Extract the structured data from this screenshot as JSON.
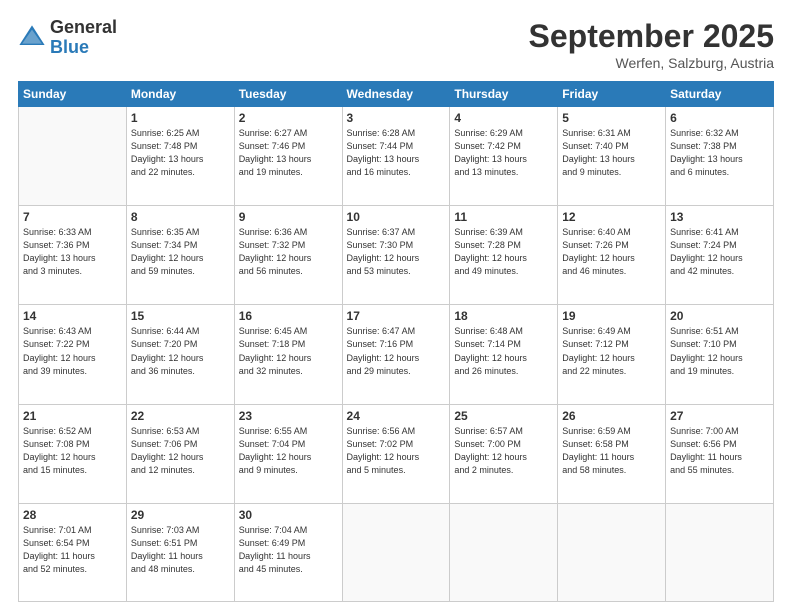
{
  "logo": {
    "general": "General",
    "blue": "Blue"
  },
  "header": {
    "month": "September 2025",
    "location": "Werfen, Salzburg, Austria"
  },
  "weekdays": [
    "Sunday",
    "Monday",
    "Tuesday",
    "Wednesday",
    "Thursday",
    "Friday",
    "Saturday"
  ],
  "weeks": [
    [
      {
        "day": "",
        "info": ""
      },
      {
        "day": "1",
        "info": "Sunrise: 6:25 AM\nSunset: 7:48 PM\nDaylight: 13 hours\nand 22 minutes."
      },
      {
        "day": "2",
        "info": "Sunrise: 6:27 AM\nSunset: 7:46 PM\nDaylight: 13 hours\nand 19 minutes."
      },
      {
        "day": "3",
        "info": "Sunrise: 6:28 AM\nSunset: 7:44 PM\nDaylight: 13 hours\nand 16 minutes."
      },
      {
        "day": "4",
        "info": "Sunrise: 6:29 AM\nSunset: 7:42 PM\nDaylight: 13 hours\nand 13 minutes."
      },
      {
        "day": "5",
        "info": "Sunrise: 6:31 AM\nSunset: 7:40 PM\nDaylight: 13 hours\nand 9 minutes."
      },
      {
        "day": "6",
        "info": "Sunrise: 6:32 AM\nSunset: 7:38 PM\nDaylight: 13 hours\nand 6 minutes."
      }
    ],
    [
      {
        "day": "7",
        "info": "Sunrise: 6:33 AM\nSunset: 7:36 PM\nDaylight: 13 hours\nand 3 minutes."
      },
      {
        "day": "8",
        "info": "Sunrise: 6:35 AM\nSunset: 7:34 PM\nDaylight: 12 hours\nand 59 minutes."
      },
      {
        "day": "9",
        "info": "Sunrise: 6:36 AM\nSunset: 7:32 PM\nDaylight: 12 hours\nand 56 minutes."
      },
      {
        "day": "10",
        "info": "Sunrise: 6:37 AM\nSunset: 7:30 PM\nDaylight: 12 hours\nand 53 minutes."
      },
      {
        "day": "11",
        "info": "Sunrise: 6:39 AM\nSunset: 7:28 PM\nDaylight: 12 hours\nand 49 minutes."
      },
      {
        "day": "12",
        "info": "Sunrise: 6:40 AM\nSunset: 7:26 PM\nDaylight: 12 hours\nand 46 minutes."
      },
      {
        "day": "13",
        "info": "Sunrise: 6:41 AM\nSunset: 7:24 PM\nDaylight: 12 hours\nand 42 minutes."
      }
    ],
    [
      {
        "day": "14",
        "info": "Sunrise: 6:43 AM\nSunset: 7:22 PM\nDaylight: 12 hours\nand 39 minutes."
      },
      {
        "day": "15",
        "info": "Sunrise: 6:44 AM\nSunset: 7:20 PM\nDaylight: 12 hours\nand 36 minutes."
      },
      {
        "day": "16",
        "info": "Sunrise: 6:45 AM\nSunset: 7:18 PM\nDaylight: 12 hours\nand 32 minutes."
      },
      {
        "day": "17",
        "info": "Sunrise: 6:47 AM\nSunset: 7:16 PM\nDaylight: 12 hours\nand 29 minutes."
      },
      {
        "day": "18",
        "info": "Sunrise: 6:48 AM\nSunset: 7:14 PM\nDaylight: 12 hours\nand 26 minutes."
      },
      {
        "day": "19",
        "info": "Sunrise: 6:49 AM\nSunset: 7:12 PM\nDaylight: 12 hours\nand 22 minutes."
      },
      {
        "day": "20",
        "info": "Sunrise: 6:51 AM\nSunset: 7:10 PM\nDaylight: 12 hours\nand 19 minutes."
      }
    ],
    [
      {
        "day": "21",
        "info": "Sunrise: 6:52 AM\nSunset: 7:08 PM\nDaylight: 12 hours\nand 15 minutes."
      },
      {
        "day": "22",
        "info": "Sunrise: 6:53 AM\nSunset: 7:06 PM\nDaylight: 12 hours\nand 12 minutes."
      },
      {
        "day": "23",
        "info": "Sunrise: 6:55 AM\nSunset: 7:04 PM\nDaylight: 12 hours\nand 9 minutes."
      },
      {
        "day": "24",
        "info": "Sunrise: 6:56 AM\nSunset: 7:02 PM\nDaylight: 12 hours\nand 5 minutes."
      },
      {
        "day": "25",
        "info": "Sunrise: 6:57 AM\nSunset: 7:00 PM\nDaylight: 12 hours\nand 2 minutes."
      },
      {
        "day": "26",
        "info": "Sunrise: 6:59 AM\nSunset: 6:58 PM\nDaylight: 11 hours\nand 58 minutes."
      },
      {
        "day": "27",
        "info": "Sunrise: 7:00 AM\nSunset: 6:56 PM\nDaylight: 11 hours\nand 55 minutes."
      }
    ],
    [
      {
        "day": "28",
        "info": "Sunrise: 7:01 AM\nSunset: 6:54 PM\nDaylight: 11 hours\nand 52 minutes."
      },
      {
        "day": "29",
        "info": "Sunrise: 7:03 AM\nSunset: 6:51 PM\nDaylight: 11 hours\nand 48 minutes."
      },
      {
        "day": "30",
        "info": "Sunrise: 7:04 AM\nSunset: 6:49 PM\nDaylight: 11 hours\nand 45 minutes."
      },
      {
        "day": "",
        "info": ""
      },
      {
        "day": "",
        "info": ""
      },
      {
        "day": "",
        "info": ""
      },
      {
        "day": "",
        "info": ""
      }
    ]
  ]
}
